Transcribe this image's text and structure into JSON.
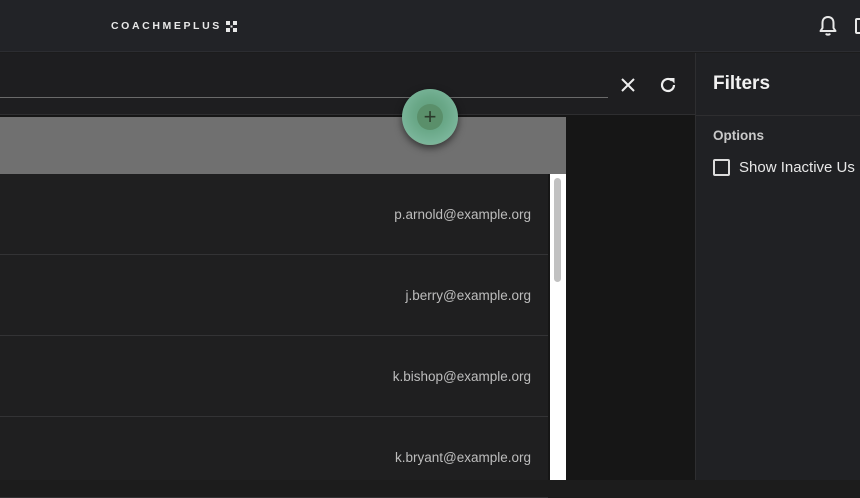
{
  "header": {
    "logo_text": "COACHMEPLUS",
    "notifications_icon": "bell-icon"
  },
  "search": {
    "value": "",
    "clear_icon": "close-icon",
    "refresh_icon": "refresh-icon"
  },
  "fab": {
    "icon": "plus-icon",
    "accent": "#6aa888"
  },
  "table": {
    "rows": [
      {
        "email": "p.arnold@example.org"
      },
      {
        "email": "j.berry@example.org"
      },
      {
        "email": "k.bishop@example.org"
      },
      {
        "email": "k.bryant@example.org"
      }
    ]
  },
  "filters": {
    "title": "Filters",
    "options_label": "Options",
    "show_inactive_label": "Show Inactive Us"
  }
}
